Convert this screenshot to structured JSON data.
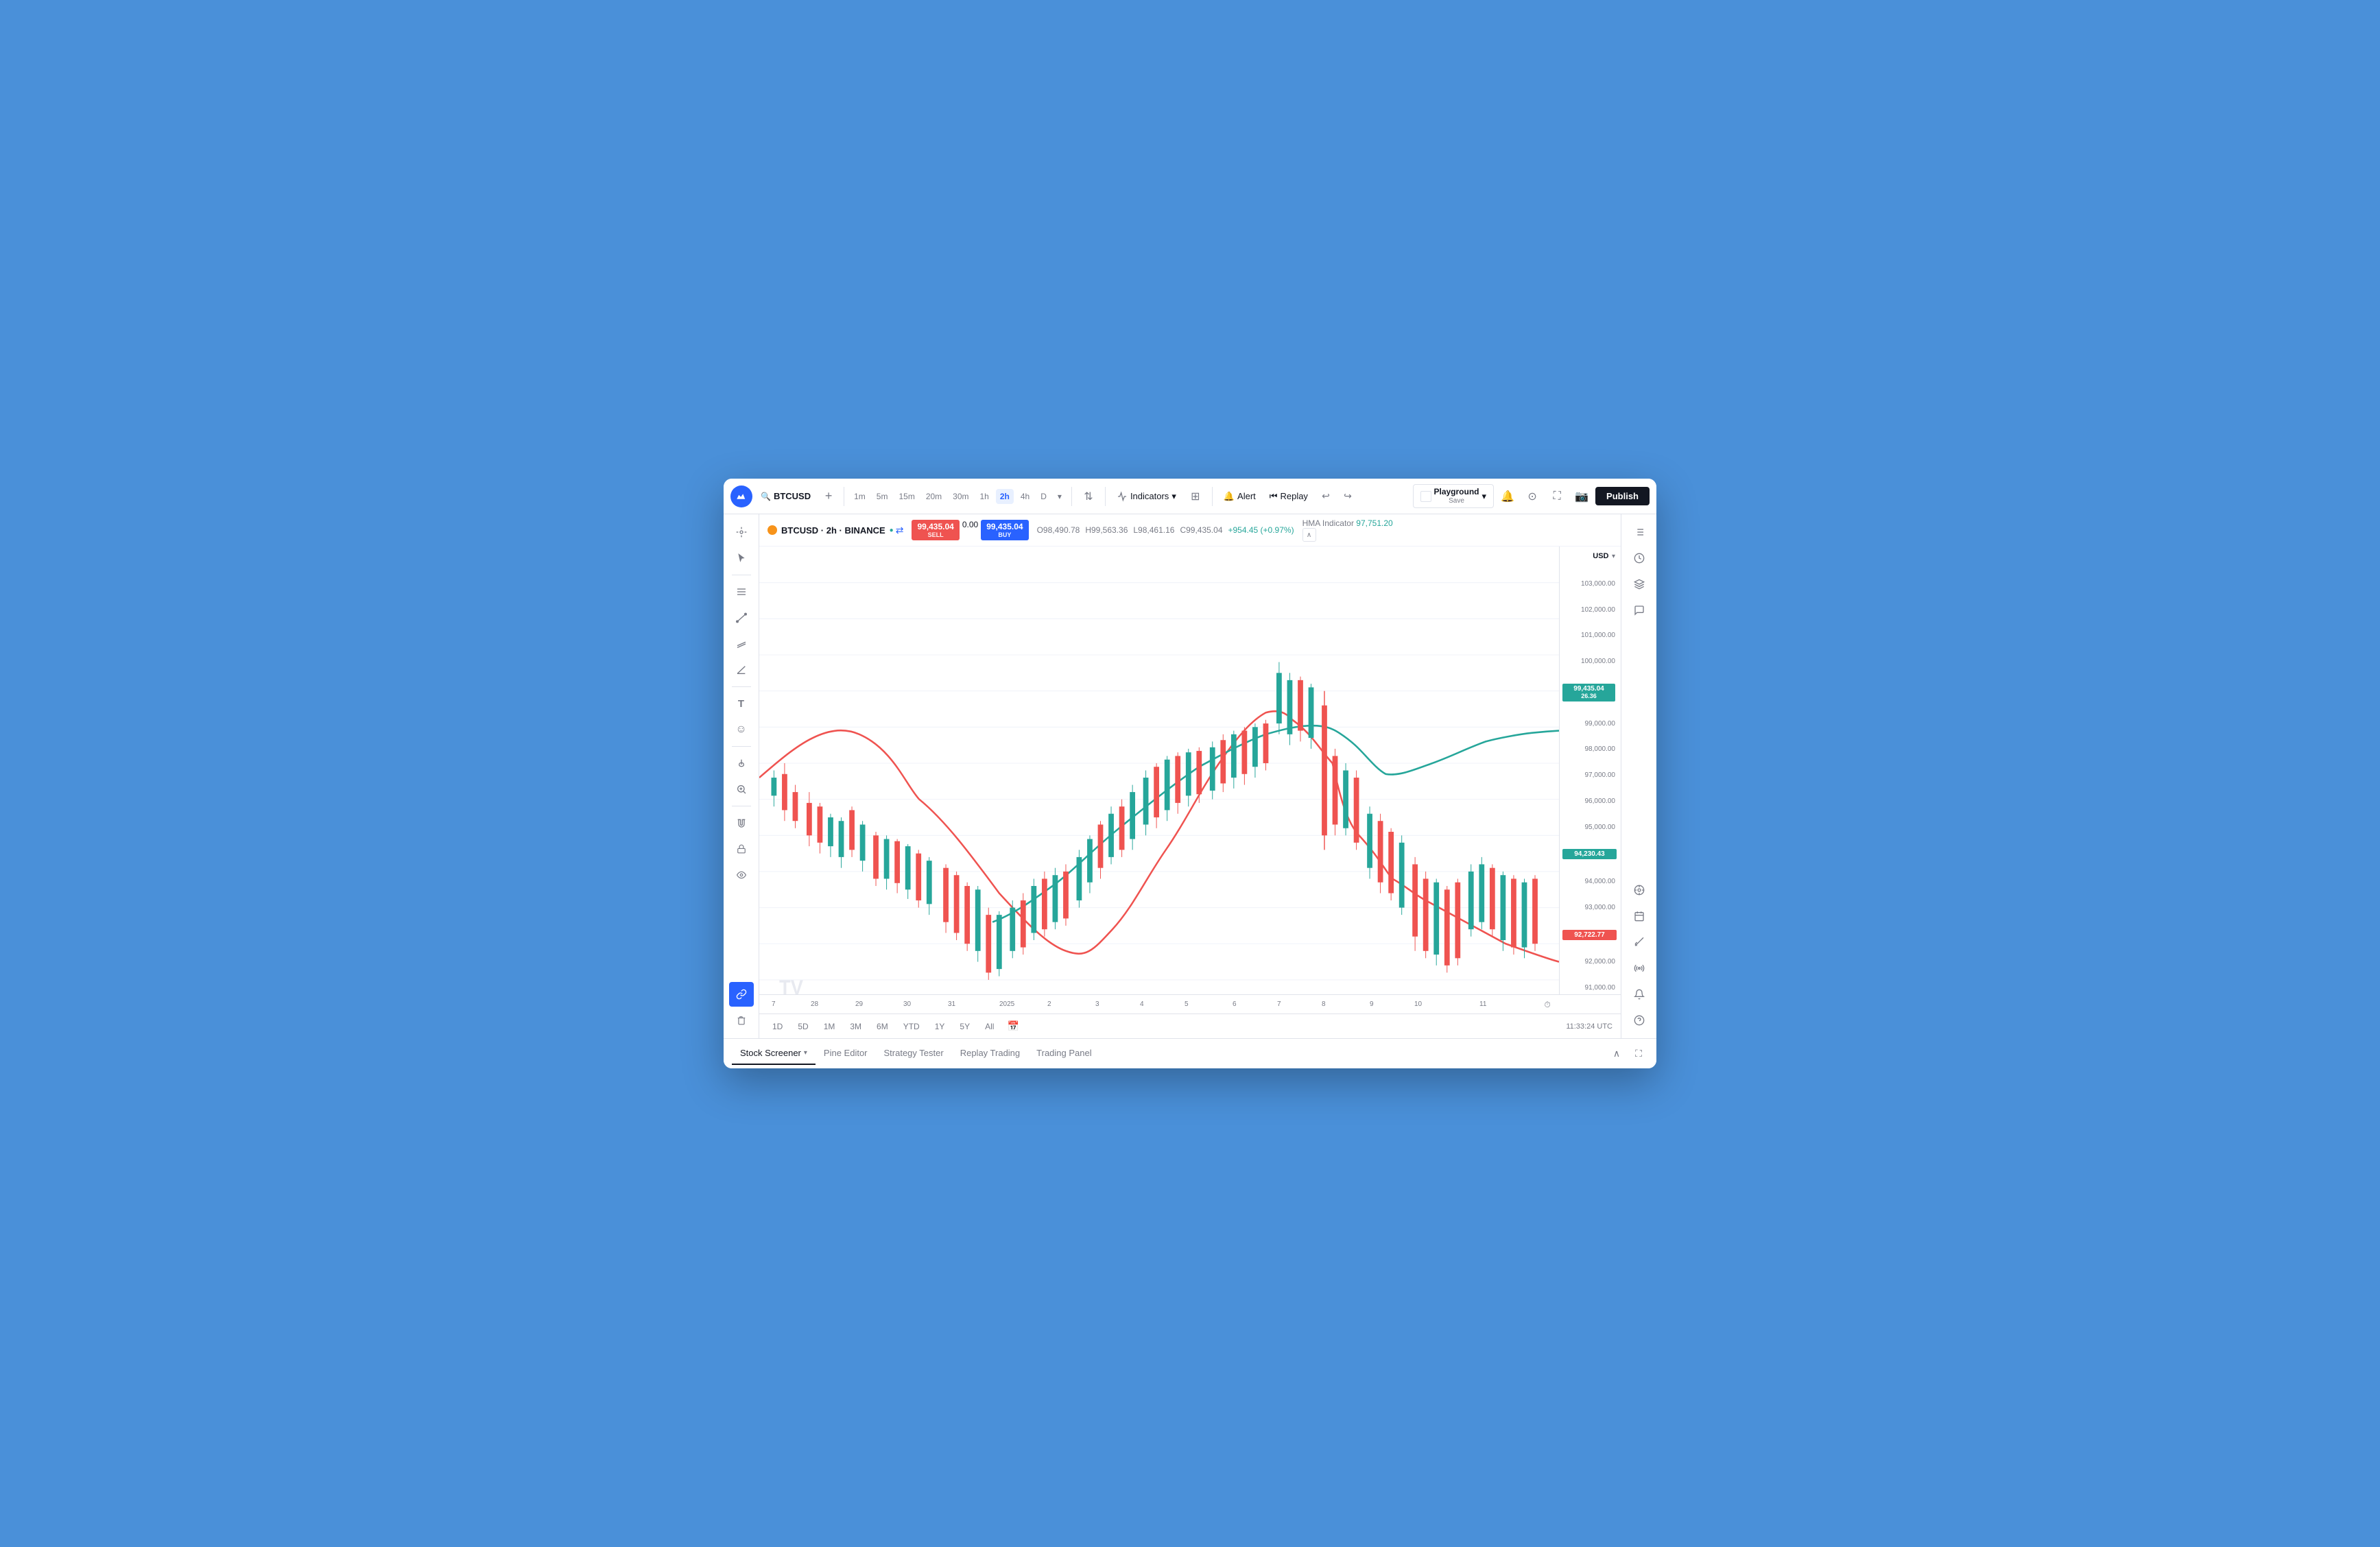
{
  "app": {
    "title": "TradingView",
    "symbol": "BTCUSD",
    "logo": "📈"
  },
  "toolbar": {
    "symbol_label": "BTCUSD",
    "add_symbol_label": "+",
    "timeframes": [
      {
        "label": "1m",
        "active": false
      },
      {
        "label": "5m",
        "active": false
      },
      {
        "label": "15m",
        "active": false
      },
      {
        "label": "20m",
        "active": false
      },
      {
        "label": "30m",
        "active": false
      },
      {
        "label": "1h",
        "active": false
      },
      {
        "label": "2h",
        "active": true
      },
      {
        "label": "4h",
        "active": false
      },
      {
        "label": "D",
        "active": false
      }
    ],
    "chart_type": "▾",
    "indicators_label": "Indicators",
    "templates_icon": "⊞",
    "alert_label": "Alert",
    "replay_label": "Replay",
    "playground_title": "Playground",
    "playground_save": "Save",
    "publish_label": "Publish"
  },
  "chart_info": {
    "symbol": "BTCUSD · 2h · BINANCE",
    "symbol_short": "BTCUSD",
    "timeframe": "2h",
    "exchange": "BINANCE",
    "open": "O98,490.78",
    "high": "H99,563.36",
    "low": "L98,461.16",
    "close": "C99,435.04",
    "change": "+954.45 (+0.97%)",
    "sell_price": "99,435.04",
    "sell_label": "SELL",
    "mid_price": "0.00",
    "buy_price": "99,435.04",
    "buy_label": "BUY",
    "hma_label": "HMA Indicator",
    "hma_value": "97,751.20"
  },
  "price_axis": {
    "levels": [
      "103,000.00",
      "102,000.00",
      "101,000.00",
      "100,000.00",
      "99,000.00",
      "98,000.00",
      "97,000.00",
      "96,000.00",
      "95,000.00",
      "94,000.00",
      "93,000.00",
      "92,000.00",
      "91,000.00"
    ],
    "current_price_badge": "99,435.04",
    "current_price_sub": "26.36",
    "hma_badge": "94,230.43",
    "hma_line_badge": "92,722.77",
    "currency": "USD"
  },
  "time_axis": {
    "labels": [
      "7",
      "28",
      "29",
      "30",
      "31",
      "2025",
      "2",
      "3",
      "4",
      "5",
      "6",
      "7",
      "8",
      "9",
      "10",
      "11"
    ],
    "utc_time": "11:33:24 UTC"
  },
  "range_buttons": [
    {
      "label": "1D",
      "active": false
    },
    {
      "label": "5D",
      "active": false
    },
    {
      "label": "1M",
      "active": false
    },
    {
      "label": "3M",
      "active": false
    },
    {
      "label": "6M",
      "active": false
    },
    {
      "label": "YTD",
      "active": false
    },
    {
      "label": "1Y",
      "active": false
    },
    {
      "label": "5Y",
      "active": false
    },
    {
      "label": "All",
      "active": false
    }
  ],
  "bottom_tabs": [
    {
      "label": "Stock Screener",
      "active": true,
      "has_dropdown": true
    },
    {
      "label": "Pine Editor",
      "active": false,
      "has_dropdown": false
    },
    {
      "label": "Strategy Tester",
      "active": false,
      "has_dropdown": false
    },
    {
      "label": "Replay Trading",
      "active": false,
      "has_dropdown": false
    },
    {
      "label": "Trading Panel",
      "active": false,
      "has_dropdown": false
    }
  ],
  "left_tools": [
    {
      "icon": "✛",
      "name": "crosshair"
    },
    {
      "icon": "↖",
      "name": "cursor"
    },
    {
      "icon": "☰",
      "name": "drawing-tools"
    },
    {
      "icon": "✏",
      "name": "trend-line"
    },
    {
      "icon": "⫒",
      "name": "channel"
    },
    {
      "icon": "∠",
      "name": "angle"
    },
    {
      "icon": "T",
      "name": "text"
    },
    {
      "icon": "☺",
      "name": "emoji"
    },
    {
      "icon": "✒",
      "name": "brush"
    },
    {
      "icon": "🔍",
      "name": "zoom"
    },
    {
      "icon": "⌂",
      "name": "magnet"
    },
    {
      "icon": "🔒",
      "name": "lock"
    },
    {
      "icon": "👁",
      "name": "eye"
    },
    {
      "icon": "🔗",
      "name": "link"
    },
    {
      "icon": "🗑",
      "name": "trash"
    }
  ],
  "right_tools": [
    {
      "icon": "☰",
      "name": "watchlist"
    },
    {
      "icon": "⏱",
      "name": "history"
    },
    {
      "icon": "◫",
      "name": "layers"
    },
    {
      "icon": "💬",
      "name": "chat"
    },
    {
      "icon": "🎯",
      "name": "crosshair-right"
    },
    {
      "icon": "📅",
      "name": "calendar"
    },
    {
      "icon": "↔",
      "name": "measure"
    },
    {
      "icon": "📡",
      "name": "broadcast"
    },
    {
      "icon": "🔔",
      "name": "alerts"
    },
    {
      "icon": "❓",
      "name": "help"
    }
  ]
}
